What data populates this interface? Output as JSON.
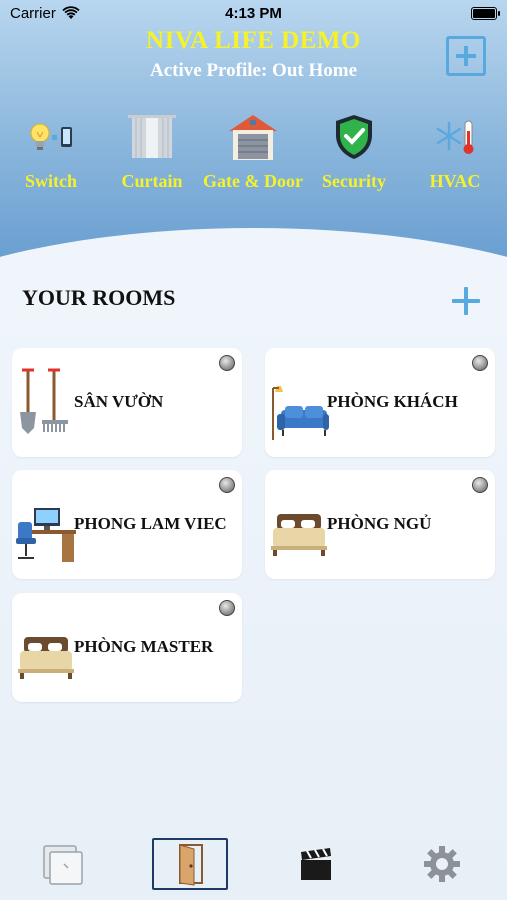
{
  "status_bar": {
    "carrier": "Carrier",
    "time": "4:13 PM"
  },
  "header": {
    "title": "NIVA LIFE DEMO",
    "profile": "Active Profile: Out Home"
  },
  "categories": [
    {
      "label": "Switch",
      "icon": "bulb-switch-icon"
    },
    {
      "label": "Curtain",
      "icon": "curtain-icon"
    },
    {
      "label": "Gate & Door",
      "icon": "garage-icon"
    },
    {
      "label": "Security",
      "icon": "shield-check-icon"
    },
    {
      "label": "HVAC",
      "icon": "snowflake-thermometer-icon"
    }
  ],
  "rooms_section": {
    "title": "YOUR ROOMS"
  },
  "rooms": [
    {
      "label": "SÂN VƯỜN",
      "icon": "garden-tools-icon"
    },
    {
      "label": "PHÒNG KHÁCH",
      "icon": "sofa-lamp-icon"
    },
    {
      "label": "PHONG LAM VIEC",
      "icon": "office-desk-icon"
    },
    {
      "label": "PHÒNG NGỦ",
      "icon": "bed-icon"
    },
    {
      "label": "PHÒNG MASTER",
      "icon": "bed-icon"
    }
  ],
  "tabs": [
    {
      "name": "devices",
      "icon": "devices-icon",
      "active": false
    },
    {
      "name": "rooms",
      "icon": "door-icon",
      "active": true
    },
    {
      "name": "scenes",
      "icon": "clapperboard-icon",
      "active": false
    },
    {
      "name": "settings",
      "icon": "gear-icon",
      "active": false
    }
  ],
  "colors": {
    "title_yellow": "#f6f22a",
    "accent_blue": "#5aa9de",
    "header_blue": "#5e97cd"
  }
}
